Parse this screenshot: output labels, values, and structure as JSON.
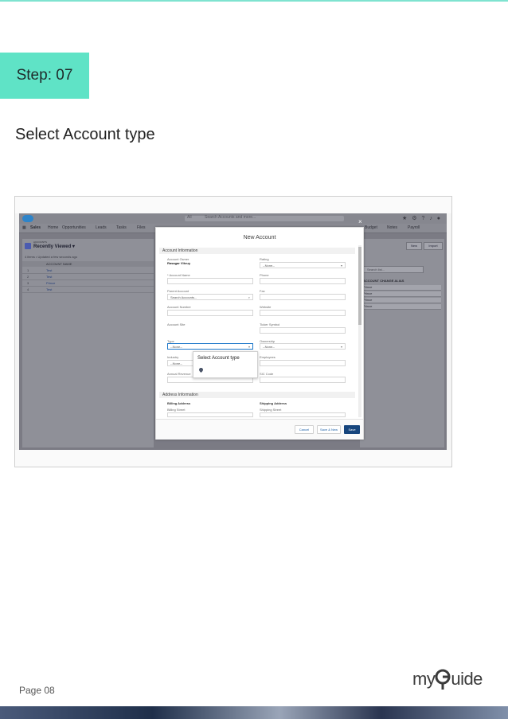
{
  "step": {
    "label": "Step: 07"
  },
  "instruction": "Select Account type",
  "footer": {
    "page": "Page 08",
    "brand_pre": "my",
    "brand_post": "uide"
  },
  "colors": {
    "accent": "#5fe3c6",
    "salesforce_blue": "#2e84c9",
    "save_button": "#16457d"
  },
  "salesforce": {
    "app_name": "Sales",
    "search_placeholder": "Search Accounts and more...",
    "search_scope": "All",
    "nav": [
      "Home",
      "Opportunities",
      "Leads",
      "Tasks",
      "Files",
      "Budget",
      "Notes",
      "Payroll"
    ],
    "list_object": "ACCOUNTS",
    "list_view": "Recently Viewed ▾",
    "list_subtitle": "4 items • Updated a few seconds ago",
    "list_column": "ACCOUNT NAME",
    "rows": [
      {
        "num": "1",
        "name": "Test"
      },
      {
        "num": "2",
        "name": "Test"
      },
      {
        "num": "3",
        "name": "Prince"
      },
      {
        "num": "4",
        "name": "Test"
      }
    ],
    "right_buttons": [
      "New",
      "Import"
    ],
    "right_search": "Search list...",
    "right_head": "ACCOUNT CHANGE ALIAS",
    "right_rows": [
      "Prince",
      "Prince",
      "Prince",
      "Prince"
    ],
    "modal": {
      "close": "×",
      "title": "New Account",
      "section_account": "Account Information",
      "owner_label": "Account Owner",
      "owner_value": "Rasagar Vikruy",
      "rating_label": "Rating",
      "rating_value": "--None--",
      "name_label": "* Account Name",
      "phone_label": "Phone",
      "parent_label": "Parent Account",
      "parent_placeholder": "Search Accounts...",
      "fax_label": "Fax",
      "number_label": "Account Number",
      "website_label": "Website",
      "site_label": "Account Site",
      "ticker_label": "Ticker Symbol",
      "type_label": "Type",
      "type_value": "--None--",
      "ownership_label": "Ownership",
      "ownership_value": "--None--",
      "industry_label": "Industry",
      "industry_value": "--None--",
      "employees_label": "Employees",
      "revenue_label": "Annual Revenue",
      "sic_label": "SIC Code",
      "section_address": "Address Information",
      "billing_label": "Billing Address",
      "shipping_label": "Shipping Address",
      "billing_street": "Billing Street",
      "shipping_street": "Shipping Street",
      "cancel": "Cancel",
      "save_new": "Save & New",
      "save": "Save"
    },
    "tooltip": "Select Account type"
  }
}
